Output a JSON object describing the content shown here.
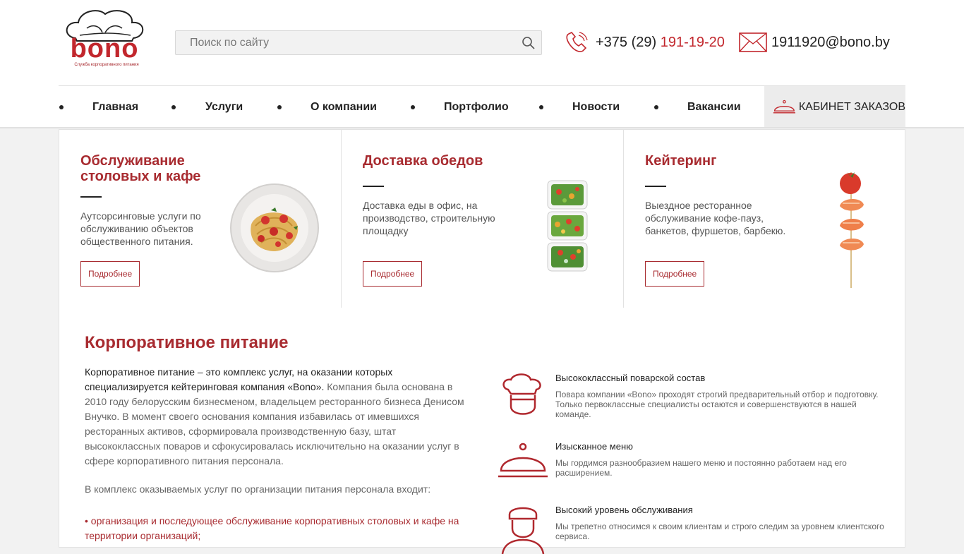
{
  "brand": {
    "name": "bono",
    "tagline": "Служба корпоративного питания"
  },
  "search": {
    "placeholder": "Поиск по сайту"
  },
  "contacts": {
    "phone_prefix": "+375 (29)",
    "phone_number": "191-19-20",
    "email": "1911920@bono.by"
  },
  "nav": {
    "items": [
      "Главная",
      "Услуги",
      "О компании",
      "Портфолио",
      "Новости",
      "Вакансии"
    ],
    "cabinet": "КАБИНЕТ ЗАКАЗОВ"
  },
  "cards": [
    {
      "title": "Обслуживание столовых и кафе",
      "text": "Аутсорсинговые услуги по обслуживанию объектов общественного питания.",
      "button": "Подробнее"
    },
    {
      "title": "Доставка обедов",
      "text": "Доставка еды в офис, на производство, строительную площадку",
      "button": "Подробнее"
    },
    {
      "title": "Кейтеринг",
      "text": "Выездное ресторанное обслуживание кофе-пауз, банкетов, фуршетов, барбекю.",
      "button": "Подробнее"
    }
  ],
  "about": {
    "title": "Корпоративное питание",
    "intro_bold": "Корпоративное питание – это комплекс услуг, на оказании которых специализируется кейтеринговая компания «Bono».",
    "intro_rest": " Компания была основана в 2010 году белорусским бизнесменом, владельцем ресторанного бизнеса Денисом Внучко. В момент своего основания компания избавилась от имевшихся ресторанных активов, сформировала производственную базу, штат высококлассных поваров и сфокусировалась исключительно на оказании услуг в сфере корпоративного питания персонала.",
    "paragraph2": "В комплекс оказываемых услуг по организации питания персонала входит:",
    "list_item": "• организация и последующее обслуживание корпоративных столовых и кафе на территории организаций;"
  },
  "features": [
    {
      "icon": "chef-icon",
      "title": "Высококлассный поварской состав",
      "text": "Повара компании «Bono» проходят строгий предварительный отбор и подготовку. Только первоклассные специалисты остаются и совершенствуются в нашей команде."
    },
    {
      "icon": "cloche-icon",
      "title": "Изысканное меню",
      "text": "Мы гордимся разнообразием нашего меню и постоянно работаем над его расширением."
    },
    {
      "icon": "waiter-icon",
      "title": "Высокий уровень обслуживания",
      "text": "Мы трепетно относимся к своим клиентам и строго следим за уровнем клиентского сервиса."
    }
  ],
  "colors": {
    "accent": "#a82b30",
    "phone_accent": "#c2272d"
  }
}
